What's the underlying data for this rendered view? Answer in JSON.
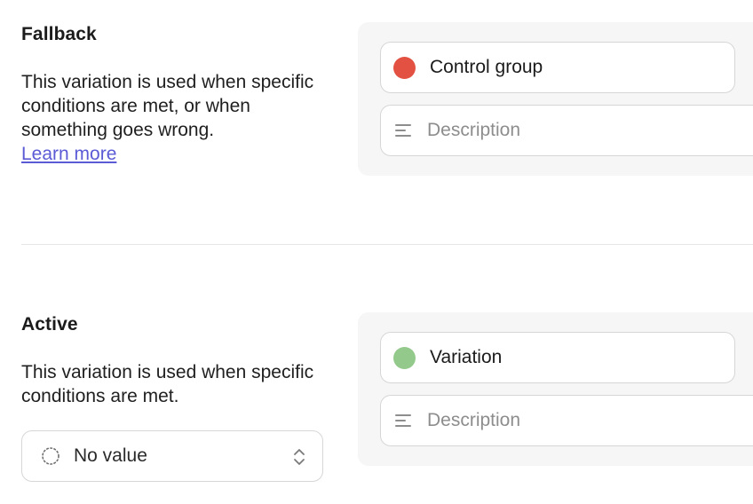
{
  "fallback": {
    "title": "Fallback",
    "description": "This variation is used when specific conditions are met, or when something goes wrong.",
    "link_label": "Learn more",
    "name_value": "Control group",
    "dot_color": "#e25141",
    "description_placeholder": "Description"
  },
  "active": {
    "title": "Active",
    "description": "This variation is used when specific conditions are met.",
    "select_value": "No value",
    "name_value": "Variation",
    "dot_color": "#93c98a",
    "description_placeholder": "Description"
  },
  "icons": {
    "description": "text-lines-icon",
    "select_status": "dotted-circle-icon",
    "select_chevron": "chevron-up-down-icon"
  },
  "colors": {
    "link": "#5b5bd6",
    "panel_bg": "#f6f6f6",
    "border": "#d6d6d6"
  }
}
